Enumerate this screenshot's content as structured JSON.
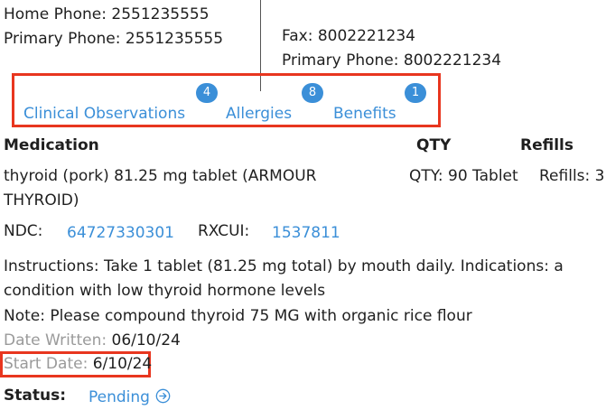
{
  "contact_left": {
    "home_phone": "Home Phone: 2551235555",
    "primary_phone": "Primary Phone: 2551235555"
  },
  "contact_right": {
    "fax": "Fax: 8002221234",
    "primary_phone": "Primary Phone: 8002221234"
  },
  "tabs": [
    {
      "label": "Clinical Observations",
      "count": "4"
    },
    {
      "label": "Allergies",
      "count": "8"
    },
    {
      "label": "Benefits",
      "count": "1"
    }
  ],
  "columns": {
    "medication": "Medication",
    "qty": "QTY",
    "refills": "Refills"
  },
  "medication": {
    "name_line1": "thyroid (pork) 81.25 mg tablet (ARMOUR",
    "name_line2": "THYROID)",
    "qty": "QTY: 90 Tablet",
    "refills": "Refills: 3",
    "ndc_label": "NDC:",
    "ndc_value": "64727330301",
    "rxcui_label": "RXCUI:",
    "rxcui_value": "1537811",
    "instructions_line1": "Instructions: Take 1 tablet (81.25 mg total) by mouth daily. Indications: a",
    "instructions_line2": "condition with low thyroid hormone levels",
    "note": "Note: Please compound thyroid 75 MG with organic rice flour",
    "date_written_label": "Date Written:",
    "date_written_value": "06/10/24",
    "start_date_label": "Start Date:",
    "start_date_value": "6/10/24",
    "status_label": "Status:",
    "status_value": "Pending"
  },
  "colors": {
    "accent": "#3b8fd8",
    "highlight": "#e8361f"
  },
  "icons": {
    "status_action": "arrow-circle-right-icon"
  }
}
